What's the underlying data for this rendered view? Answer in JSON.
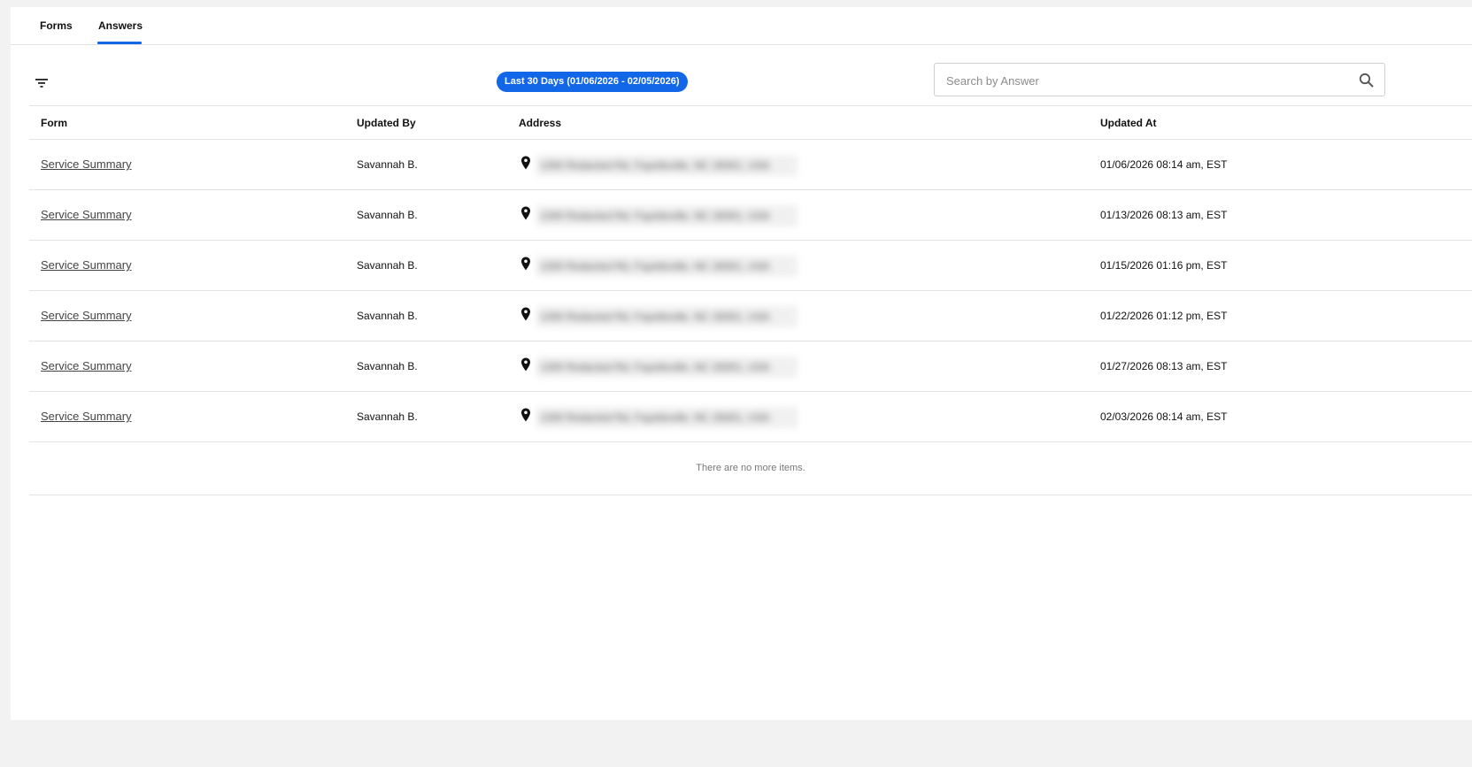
{
  "tabs": {
    "forms_label": "Forms",
    "answers_label": "Answers",
    "active": "Answers"
  },
  "toolbar": {
    "filter_icon": "filter-icon",
    "date_range_chip": "Last 30 Days (01/06/2026 - 02/05/2026)",
    "search_placeholder": "Search by Answer",
    "search_value": ""
  },
  "table": {
    "headers": {
      "form": "Form",
      "updated_by": "Updated By",
      "address": "Address",
      "updated_at": "Updated At"
    },
    "rows": [
      {
        "form": "Service Summary",
        "updated_by": "Savannah B.",
        "address": "1300 Redacted Rd, Fayetteville, NC 28301, USA",
        "updated_at": "01/06/2026 08:14 am, EST"
      },
      {
        "form": "Service Summary",
        "updated_by": "Savannah B.",
        "address": "1300 Redacted Rd, Fayetteville, NC 28301, USA",
        "updated_at": "01/13/2026 08:13 am, EST"
      },
      {
        "form": "Service Summary",
        "updated_by": "Savannah B.",
        "address": "1300 Redacted Rd, Fayetteville, NC 28301, USA",
        "updated_at": "01/15/2026 01:16 pm, EST"
      },
      {
        "form": "Service Summary",
        "updated_by": "Savannah B.",
        "address": "1300 Redacted Rd, Fayetteville, NC 28301, USA",
        "updated_at": "01/22/2026 01:12 pm, EST"
      },
      {
        "form": "Service Summary",
        "updated_by": "Savannah B.",
        "address": "1300 Redacted Rd, Fayetteville, NC 28301, USA",
        "updated_at": "01/27/2026 08:13 am, EST"
      },
      {
        "form": "Service Summary",
        "updated_by": "Savannah B.",
        "address": "1300 Redacted Rd, Fayetteville, NC 28301, USA",
        "updated_at": "02/03/2026 08:14 am, EST"
      }
    ],
    "end_message": "There are no more items."
  },
  "colors": {
    "accent": "#1266e8",
    "border": "#e3e3e3",
    "background": "#f2f2f2"
  }
}
